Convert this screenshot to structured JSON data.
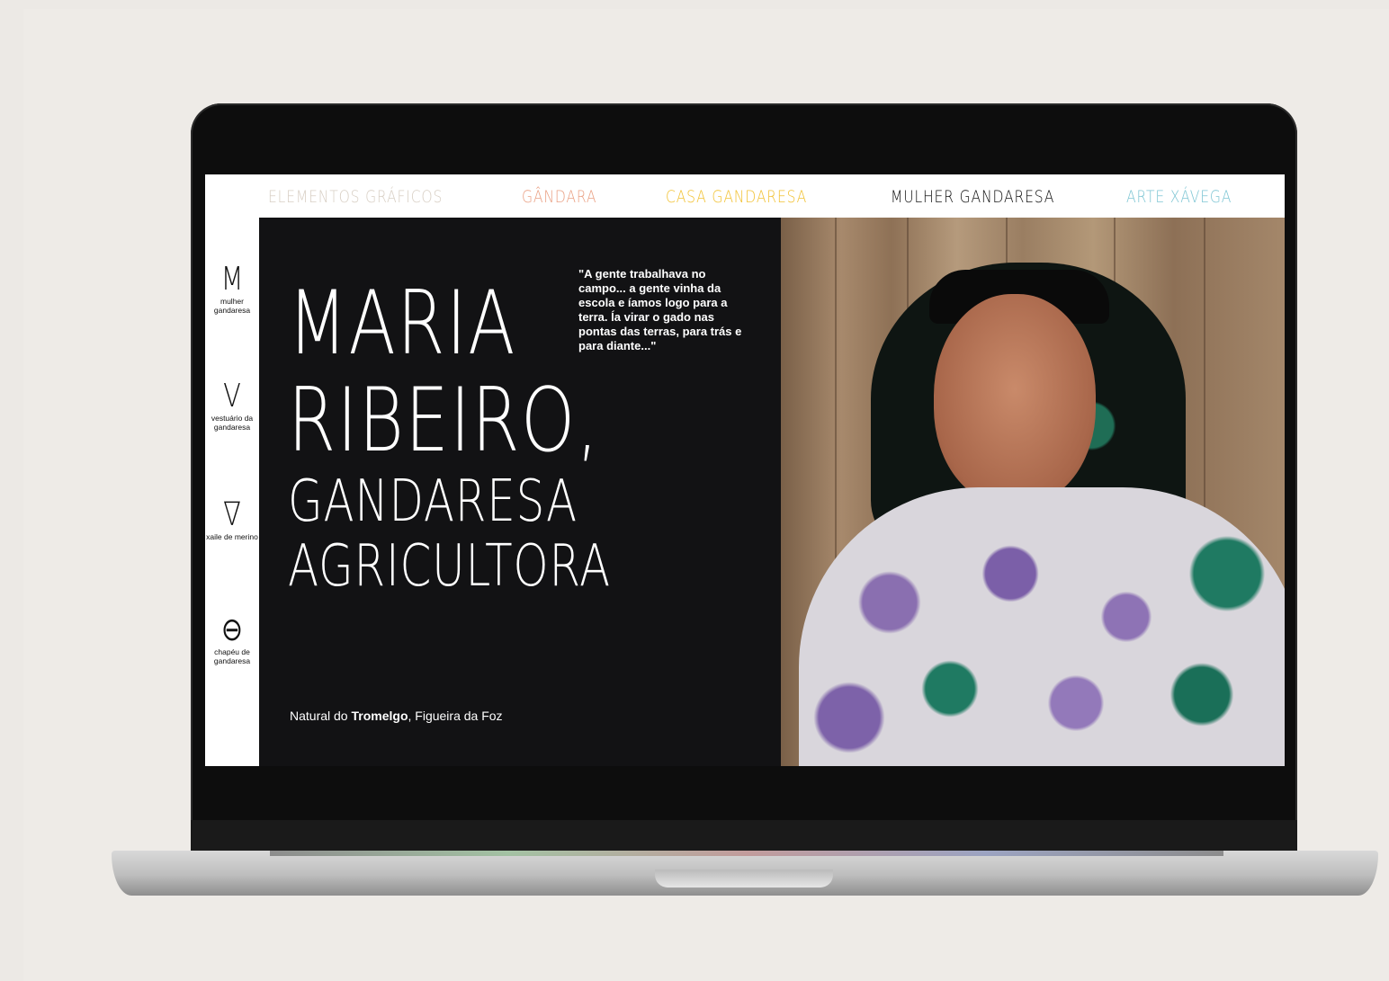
{
  "nav": {
    "items": [
      {
        "label": "ELEMENTOS GRÁFICOS",
        "color": "#d8cfc4"
      },
      {
        "label": "GÂNDARA",
        "color": "#eaa083"
      },
      {
        "label": "CASA GANDARESA",
        "color": "#f2c234"
      },
      {
        "label": "MULHER GANDARESA",
        "color": "#111111"
      },
      {
        "label": "ARTE XÁVEGA",
        "color": "#7fc6d4"
      }
    ]
  },
  "sidebar": {
    "items": [
      {
        "glyph": "M",
        "label": "mulher gandaresa",
        "icon": "letter-m-icon"
      },
      {
        "glyph": "V",
        "label": "vestuário da gandaresa",
        "icon": "letter-v-icon"
      },
      {
        "glyph": "∇",
        "label": "xaile de merino",
        "icon": "shawl-triangle-icon"
      },
      {
        "glyph": "⊖",
        "label": "chapéu de gandaresa",
        "icon": "hat-icon"
      }
    ]
  },
  "hero": {
    "line1": "MARIA",
    "line2": "RIBEIRO,",
    "line3": "GANDARESA",
    "line4": "AGRICULTORA",
    "quote": "\"A gente trabalhava no campo... a gente vinha da escola e íamos logo para a terra. Ía virar o gado nas pontas das terras, para trás e para diante...\"",
    "origin_prefix": "Natural do ",
    "origin_place": "Tromelgo",
    "origin_suffix": ", Figueira da Foz"
  },
  "colors": {
    "dark_panel": "#121214",
    "page_background": "#eeebe7"
  }
}
